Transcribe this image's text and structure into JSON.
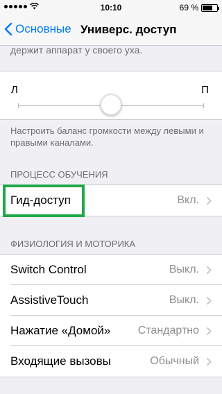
{
  "status": {
    "time": "10:10",
    "battery": "69 %",
    "battery_level": 0.69
  },
  "nav": {
    "back_label": "Основные",
    "title": "Универс. доступ"
  },
  "cut_off_text": "держит аппарат у своего уха.",
  "balance": {
    "left_label": "Л",
    "right_label": "П",
    "value": 0.5,
    "footer": "Настроить баланс громкости между левыми и правыми каналами."
  },
  "learning": {
    "header": "ПРОЦЕСС ОБУЧЕНИЯ",
    "guided_access": {
      "label": "Гид-доступ",
      "value": "Вкл."
    }
  },
  "physiology": {
    "header": "ФИЗИОЛОГИЯ И МОТОРИКА",
    "items": [
      {
        "label": "Switch Control",
        "value": "Выкл."
      },
      {
        "label": "AssistiveTouch",
        "value": "Выкл."
      },
      {
        "label": "Нажатие «Домой»",
        "value": "Стандартно"
      },
      {
        "label": "Входящие вызовы",
        "value": "Обычный"
      }
    ]
  },
  "colors": {
    "accent": "#007aff",
    "highlight": "#1fa84a",
    "background": "#efeff4",
    "secondary_text": "#8e8e93"
  }
}
